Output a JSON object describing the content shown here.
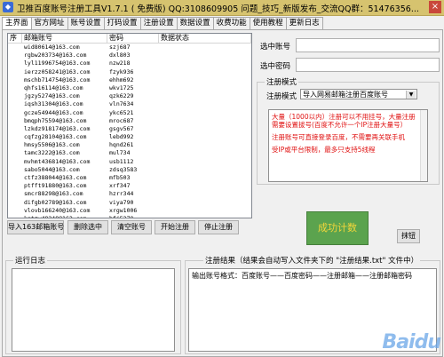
{
  "window": {
    "title": "卫推百度账号注册工具V1.7.1 ( 免费版)    QQ:3108609905  问题_技巧_新版发布_交流QQ群：51476356...",
    "close": "×"
  },
  "tabs": [
    "主界面",
    "官方网址",
    "账号设置",
    "打码设置",
    "注册设置",
    "数据设置",
    "收费功能",
    "使用教程",
    "更新日志"
  ],
  "table": {
    "columns": [
      "序",
      "邮箱账号",
      "密码",
      "数据状态"
    ],
    "rows": [
      {
        "email": "wid80614@163.com",
        "password": "szj687"
      },
      {
        "email": "rgbw203734@163.com",
        "password": "dxl803"
      },
      {
        "email": "lyl11996754@163.com",
        "password": "nzw218"
      },
      {
        "email": "ierzz058241@163.com",
        "password": "fzyk936"
      },
      {
        "email": "mschb714754@163.com",
        "password": "ehhm692"
      },
      {
        "email": "qhfs16114@163.com",
        "password": "wkv1725"
      },
      {
        "email": "jgzy5274@163.com",
        "password": "qzk6229"
      },
      {
        "email": "iqsh31304@163.com",
        "password": "vln7634"
      },
      {
        "email": "gcze54944@163.com",
        "password": "ykc6521"
      },
      {
        "email": "bmqph75594@163.com",
        "password": "mroc687"
      },
      {
        "email": "lzkdz918174@163.com",
        "password": "gsgv567"
      },
      {
        "email": "cqfzg28104@163.com",
        "password": "lebd992"
      },
      {
        "email": "hmsy5506@163.com",
        "password": "hqnd261"
      },
      {
        "email": "tamc3222@163.com",
        "password": "mul734"
      },
      {
        "email": "mvhmt436814@163.com",
        "password": "usb1112"
      },
      {
        "email": "sabo5044@163.com",
        "password": "zdsq3583"
      },
      {
        "email": "ctfz388044@163.com",
        "password": "mfb503"
      },
      {
        "email": "ptfft91880@163.com",
        "password": "xrf347"
      },
      {
        "email": "smcr88298@163.com",
        "password": "hzrr344"
      },
      {
        "email": "difgb02789@163.com",
        "password": "viya790"
      },
      {
        "email": "vlovb166240@163.com",
        "password": "xrgw1006"
      },
      {
        "email": "kgtzw48248@163.com",
        "password": "hfj5370"
      },
      {
        "email": "yine77584@163.com",
        "password": "xry005"
      }
    ]
  },
  "buttons": {
    "import": "导入163邮箱账号",
    "delete": "删除选中",
    "clear": "清空账号",
    "start": "开始注册",
    "stop": "停止注册",
    "screenshot": "抹钮"
  },
  "right": {
    "selected_account_label": "选中账号",
    "selected_password_label": "选中密码",
    "selected_account_value": "",
    "selected_password_value": "",
    "mode_group_title": "注册模式",
    "mode_label": "注册模式",
    "mode_value": "导入网易邮箱注册百度账号",
    "notes": [
      "大量（1000以内）注册可以不用挂号，大量注册需要设置拔号(百度不允许一个IP注册大量号）",
      "注册账号可直接登录百度，不需要再关联手机",
      "受IP或平台限制，最多只支持5线程"
    ],
    "success_button": "成功计数"
  },
  "log": {
    "title": "运行日志",
    "content": ""
  },
  "results": {
    "title": "注册结果（结果会自动写入文件夹下的 \"注册结果.txt\" 文件中）",
    "header_line": "输出账号格式：百度账号——百度密码——注册邮箱——注册邮箱密码"
  },
  "watermark": "Baidu"
}
